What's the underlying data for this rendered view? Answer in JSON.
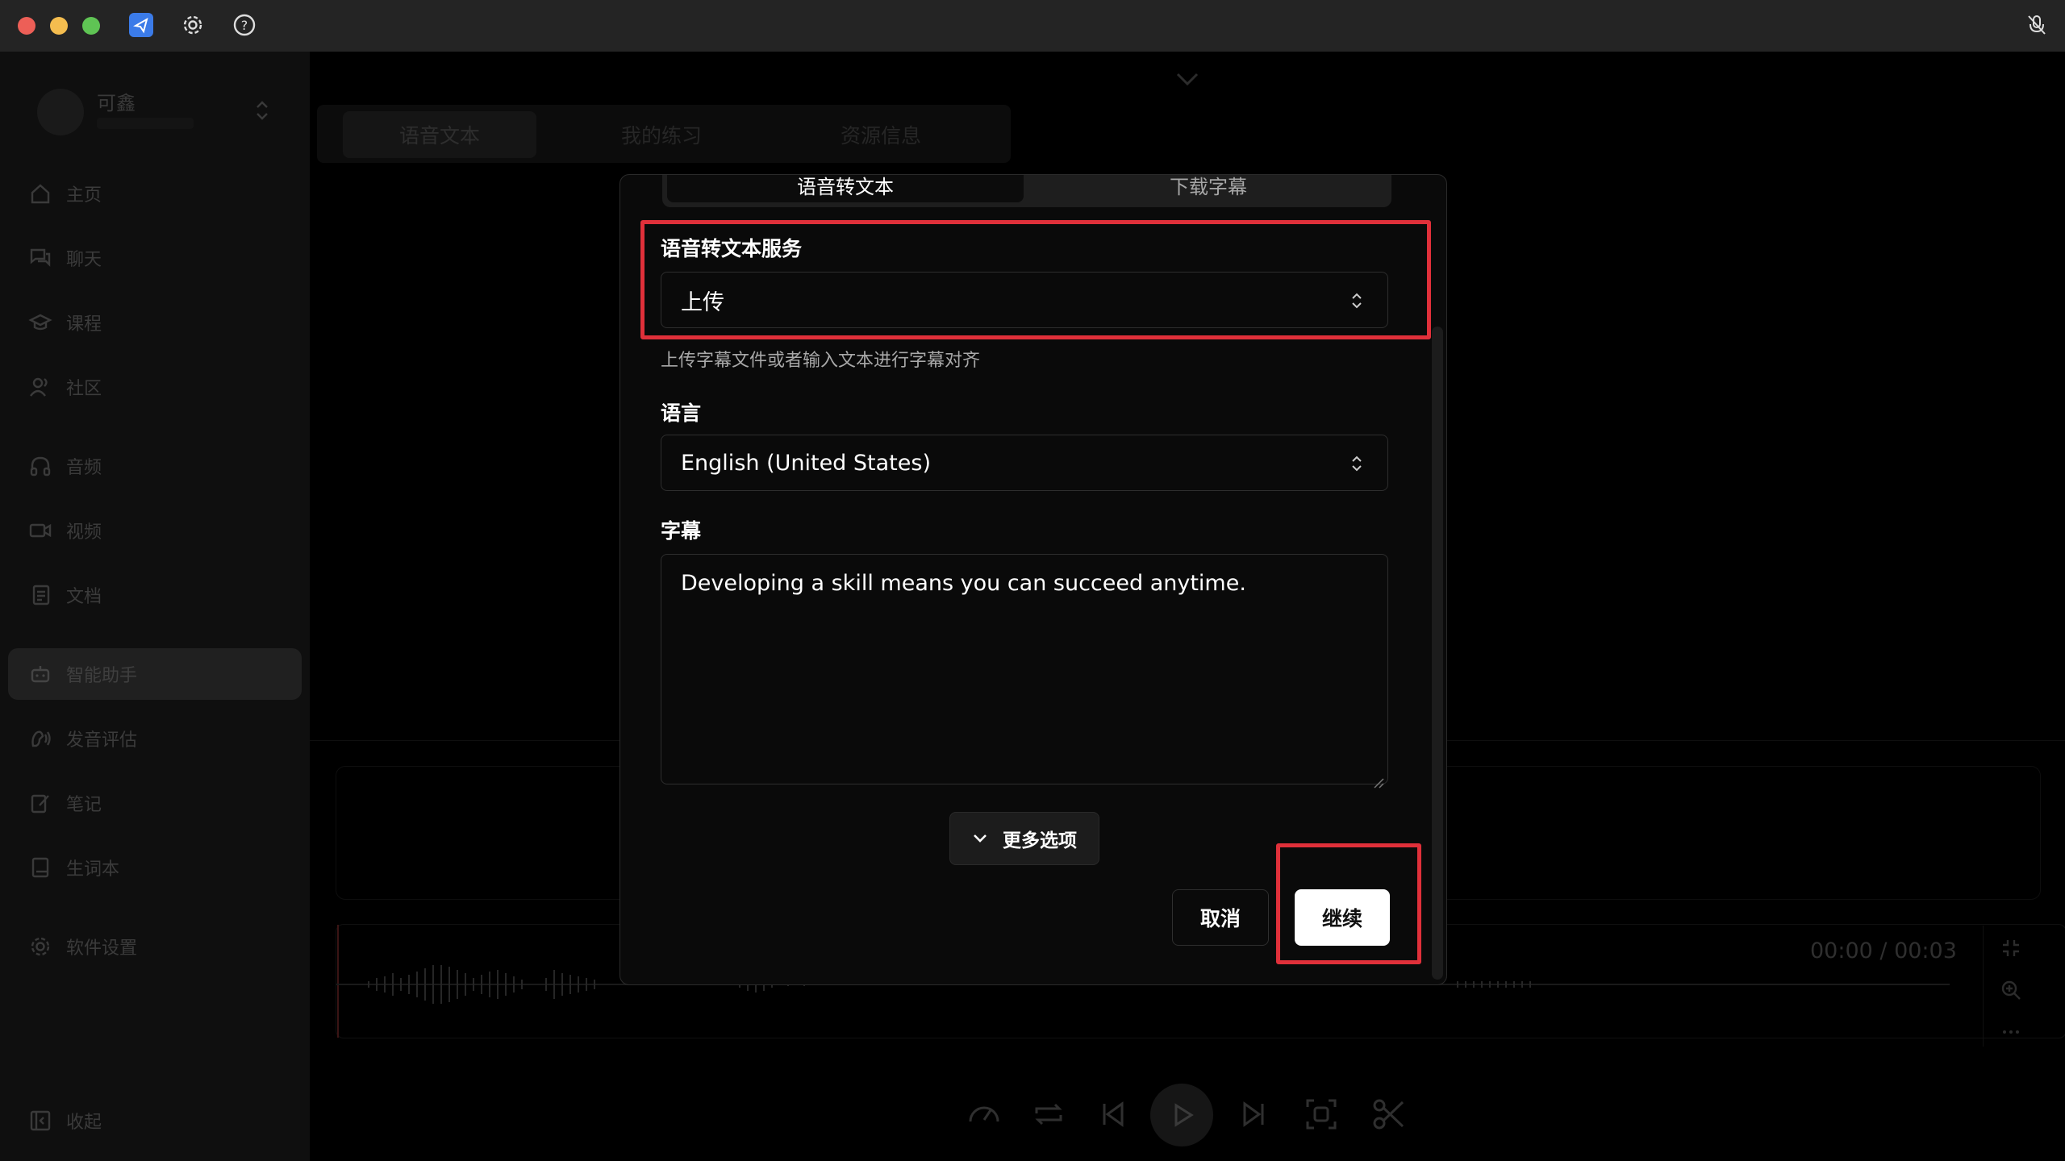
{
  "sidebar": {
    "user_name": "可鑫",
    "items": [
      {
        "label": "主页",
        "icon": "home-icon"
      },
      {
        "label": "聊天",
        "icon": "chat-icon"
      },
      {
        "label": "课程",
        "icon": "graduation-cap-icon"
      },
      {
        "label": "社区",
        "icon": "community-icon"
      },
      {
        "label": "音频",
        "icon": "headphones-icon"
      },
      {
        "label": "视频",
        "icon": "video-icon"
      },
      {
        "label": "文档",
        "icon": "document-icon"
      },
      {
        "label": "智能助手",
        "icon": "bot-icon"
      },
      {
        "label": "发音评估",
        "icon": "speech-icon"
      },
      {
        "label": "笔记",
        "icon": "note-icon"
      },
      {
        "label": "生词本",
        "icon": "book-icon"
      },
      {
        "label": "软件设置",
        "icon": "gear-icon"
      }
    ],
    "collapse_label": "收起"
  },
  "main": {
    "tabs": [
      "语音文本",
      "我的练习",
      "资源信息"
    ],
    "time_display": "00:00 / 00:03"
  },
  "modal": {
    "segments": [
      "语音转文本",
      "下载字幕"
    ],
    "service_label": "语音转文本服务",
    "service_value": "上传",
    "service_hint": "上传字幕文件或者输入文本进行字幕对齐",
    "language_label": "语言",
    "language_value": "English (United States)",
    "subtitle_label": "字幕",
    "subtitle_text": "Developing a skill means you can succeed anytime.",
    "more_options": "更多选项",
    "cancel": "取消",
    "continue": "继续"
  },
  "colors": {
    "highlight": "#e0303a",
    "app_icon": "#3b7be8"
  }
}
